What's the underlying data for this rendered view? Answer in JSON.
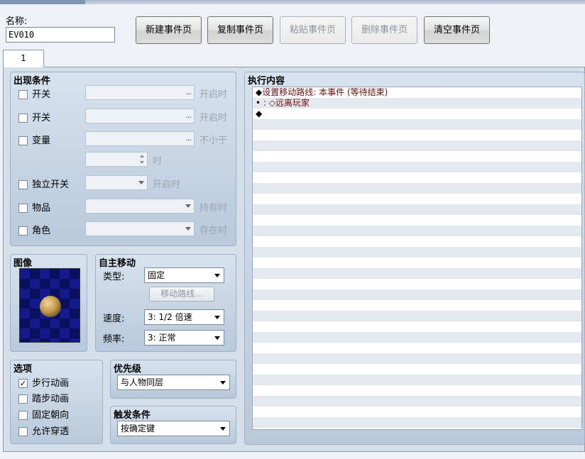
{
  "header": {
    "name_label": "名称:",
    "name_value": "EV010"
  },
  "toolbar": {
    "new_page": "新建事件页",
    "copy_page": "复制事件页",
    "paste_page": "粘贴事件页",
    "delete_page": "删除事件页",
    "clear_page": "清空事件页"
  },
  "tabs": [
    {
      "label": "1"
    }
  ],
  "conditions": {
    "title": "出现条件",
    "switch1": {
      "label": "开关",
      "hint": "开启时",
      "ellipsis": "..."
    },
    "switch2": {
      "label": "开关",
      "hint": "开启时",
      "ellipsis": "..."
    },
    "variable": {
      "label": "变量",
      "hint": "不小于",
      "ellipsis": "..."
    },
    "variable_value_hint": "时",
    "self_switch": {
      "label": "独立开关",
      "hint": "开启时"
    },
    "item": {
      "label": "物品",
      "hint": "持有时"
    },
    "actor": {
      "label": "角色",
      "hint": "存在时"
    }
  },
  "image": {
    "title": "图像"
  },
  "autonomous": {
    "title": "自主移动",
    "type_label": "类型:",
    "type_value": "固定",
    "route_button": "移动路线...",
    "speed_label": "速度:",
    "speed_value": "3: 1/2 倍速",
    "freq_label": "频率:",
    "freq_value": "3: 正常"
  },
  "options": {
    "title": "选项",
    "walking_anim": {
      "label": "步行动画",
      "checked": true
    },
    "stepping_anim": {
      "label": "踏步动画",
      "checked": false
    },
    "direction_fix": {
      "label": "固定朝向",
      "checked": false
    },
    "through": {
      "label": "允许穿透",
      "checked": false
    }
  },
  "priority": {
    "title": "优先级",
    "value": "与人物同层"
  },
  "trigger": {
    "title": "触发条件",
    "value": "按确定键"
  },
  "contents": {
    "title": "执行内容",
    "lines": [
      {
        "mark": "◆",
        "text": "设置移动路线: 本事件 (等待结束)"
      },
      {
        "mark": "•",
        "text": "            : ◇远离玩家"
      },
      {
        "mark": "◆",
        "text": ""
      }
    ]
  },
  "check_mark": "✓"
}
